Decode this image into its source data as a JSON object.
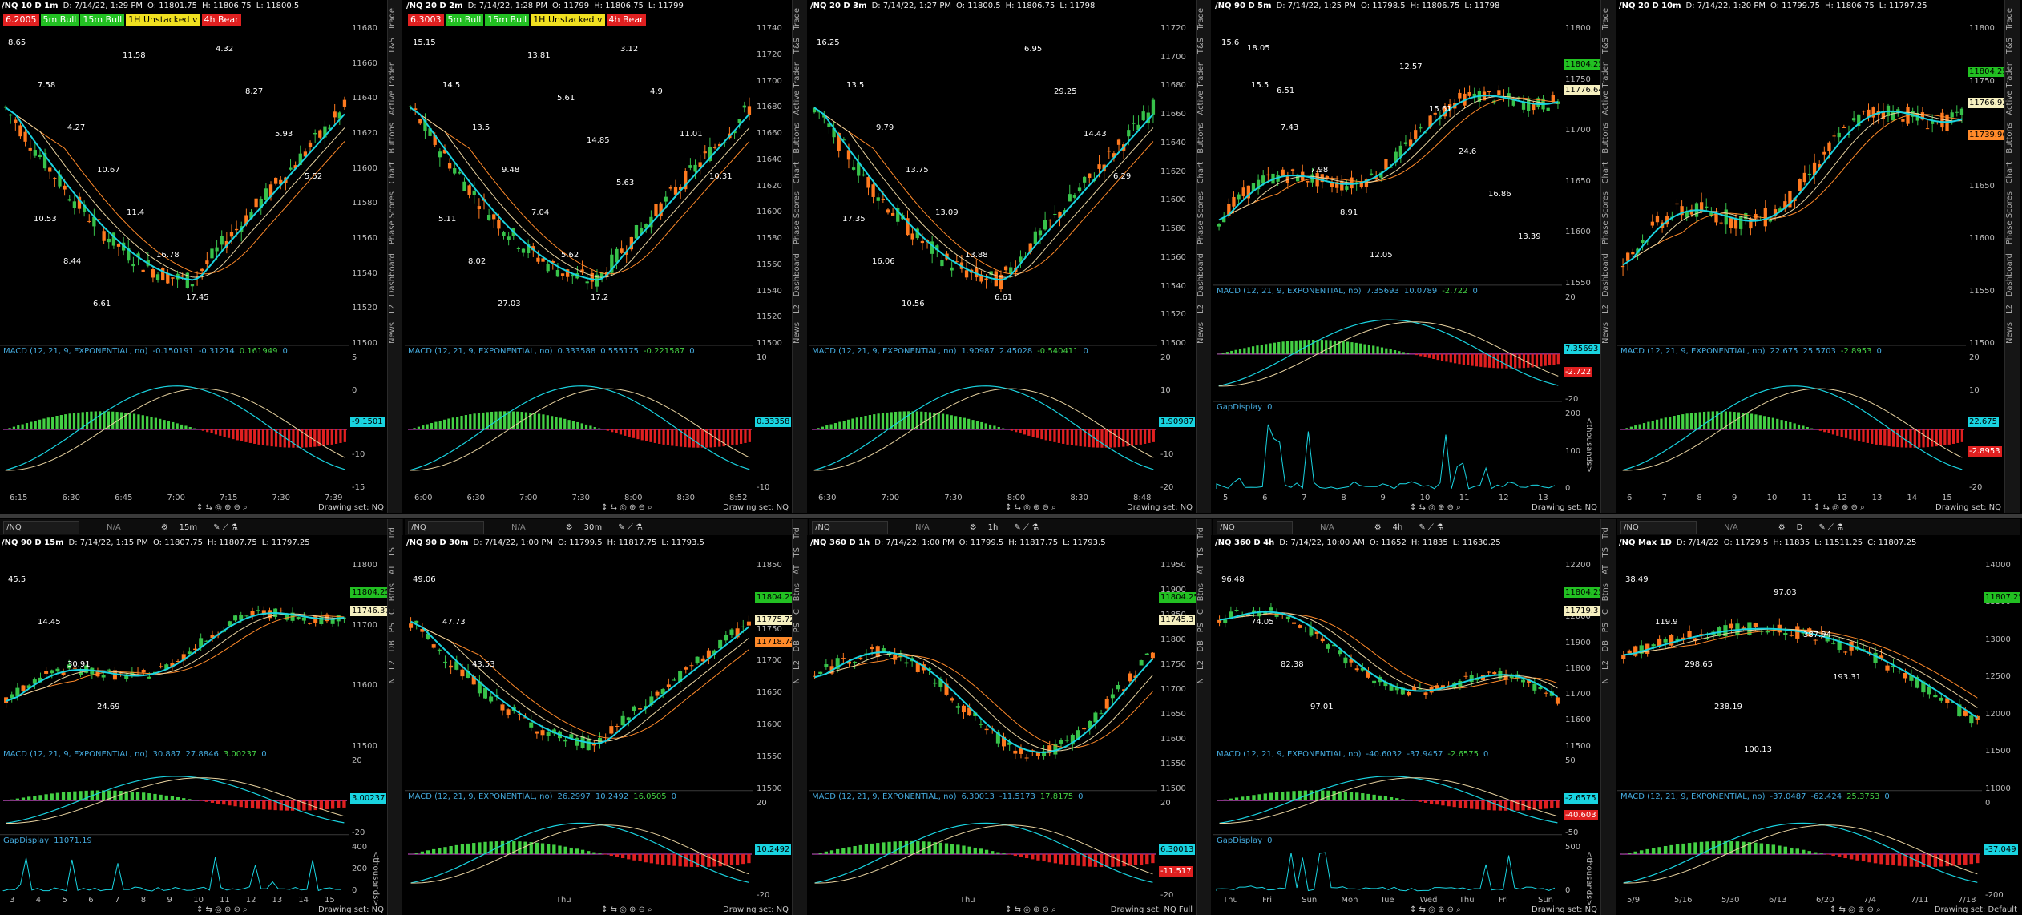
{
  "colors": {
    "bg": "#000000",
    "up": "#37c24a",
    "down": "#ff7a1f",
    "cyan": "#19d3e0",
    "orange": "#ff8a2a",
    "tan": "#e8d3a0",
    "macd_up": "#44d044",
    "macd_down": "#e02020",
    "magenta": "#ff44ff"
  },
  "top": [
    {
      "title": "/NQ 10 D 1m",
      "info": [
        "D: 7/14/22, 1:29 PM",
        "O: 11801.75",
        "H: 11806.75",
        "L: 11800.5"
      ],
      "badges": [
        {
          "t": "6.2005",
          "bg": "#e02020",
          "fg": "#fff"
        },
        {
          "t": "5m Bull",
          "bg": "#22c022",
          "fg": "#fff"
        },
        {
          "t": "15m Bull",
          "bg": "#22c022",
          "fg": "#fff"
        },
        {
          "t": "1H Unstacked v",
          "bg": "#f0e020",
          "fg": "#000"
        },
        {
          "t": "4h Bear",
          "bg": "#e02020",
          "fg": "#fff"
        }
      ],
      "yticks": [
        "11680",
        "11660",
        "11640",
        "11620",
        "11600",
        "11580",
        "11560",
        "11540",
        "11520",
        "11500"
      ],
      "annotations": [
        "8.65",
        "7.58",
        "4.27",
        "10.67",
        "11.4",
        "16.78",
        "17.45",
        "4.32",
        "8.27",
        "5.93",
        "5.52",
        "10.53",
        "8.44",
        "6.61",
        "11.58"
      ],
      "macd": [
        "MACD (12, 21, 9, EXPONENTIAL, no)",
        "-0.150191",
        "-0.31214",
        "0.161949",
        "0"
      ],
      "macdticks": [
        "5",
        "0",
        "-5",
        "-10",
        "-15"
      ],
      "macd_tag": "-9.1501",
      "xticks": [
        "6:15",
        "6:30",
        "6:45",
        "7:00",
        "7:15",
        "7:30",
        "7:39"
      ],
      "footer": "Drawing set: NQ",
      "tabs": [
        "Trade",
        "T&S",
        "Active Trader",
        "Buttons",
        "Chart",
        "Phase Scores",
        "Dashboard",
        "L2",
        "News"
      ]
    },
    {
      "title": "/NQ 20 D 2m",
      "info": [
        "D: 7/14/22, 1:28 PM",
        "O: 11799",
        "H: 11806.75",
        "L: 11799"
      ],
      "badges": [
        {
          "t": "6.3003",
          "bg": "#e02020",
          "fg": "#fff"
        },
        {
          "t": "5m Bull",
          "bg": "#22c022",
          "fg": "#fff"
        },
        {
          "t": "15m Bull",
          "bg": "#22c022",
          "fg": "#fff"
        },
        {
          "t": "1H Unstacked v",
          "bg": "#f0e020",
          "fg": "#000"
        },
        {
          "t": "4h Bear",
          "bg": "#e02020",
          "fg": "#fff"
        }
      ],
      "yticks": [
        "11740",
        "11720",
        "11700",
        "11680",
        "11660",
        "11640",
        "11620",
        "11600",
        "11580",
        "11560",
        "11540",
        "11520",
        "11500"
      ],
      "annotations": [
        "15.15",
        "14.5",
        "13.5",
        "9.48",
        "7.04",
        "5.62",
        "17.2",
        "3.12",
        "4.9",
        "11.01",
        "10.31",
        "5.11",
        "8.02",
        "27.03",
        "13.81",
        "5.61",
        "14.85",
        "5.63"
      ],
      "macd": [
        "MACD (12, 21, 9, EXPONENTIAL, no)",
        "0.333588",
        "0.555175",
        "-0.221587",
        "0"
      ],
      "macdticks": [
        "10",
        "0",
        "-10"
      ],
      "macd_tag": "0.33358",
      "xticks": [
        "6:00",
        "6:30",
        "7:00",
        "7:30",
        "8:00",
        "8:30",
        "8:52"
      ],
      "footer": "Drawing set: NQ",
      "tabs": [
        "Trade",
        "T&S",
        "Active Trader",
        "Buttons",
        "Chart",
        "Phase Scores",
        "Dashboard",
        "L2",
        "News"
      ]
    },
    {
      "title": "/NQ 20 D 3m",
      "info": [
        "D: 7/14/22, 1:27 PM",
        "O: 11800.5",
        "H: 11806.75",
        "L: 11798"
      ],
      "badges": [],
      "yticks": [
        "11720",
        "11700",
        "11680",
        "11660",
        "11640",
        "11620",
        "11600",
        "11580",
        "11560",
        "11540",
        "11520",
        "11500"
      ],
      "annotations": [
        "16.25",
        "13.5",
        "9.79",
        "13.75",
        "13.09",
        "13.88",
        "6.61",
        "6.95",
        "29.25",
        "14.43",
        "6.29",
        "17.35",
        "16.06",
        "10.56"
      ],
      "macd": [
        "MACD (12, 21, 9, EXPONENTIAL, no)",
        "1.90987",
        "2.45028",
        "-0.540411",
        "0"
      ],
      "macdticks": [
        "20",
        "10",
        "0",
        "-10",
        "-20"
      ],
      "macd_tag": "1.90987",
      "xticks": [
        "6:30",
        "7:00",
        "7:30",
        "8:00",
        "8:30",
        "8:48"
      ],
      "footer": "Drawing set: NQ",
      "tabs": [
        "Trade",
        "T&S",
        "Active Trader",
        "Buttons",
        "Chart",
        "Phase Scores",
        "Dashboard",
        "L2",
        "News"
      ]
    },
    {
      "title": "/NQ 90 D 5m",
      "info": [
        "D: 7/14/22, 1:25 PM",
        "O: 11798.5",
        "H: 11806.75",
        "L: 11798"
      ],
      "badges": [],
      "yticks": [
        "11800",
        "11750",
        "11700",
        "11650",
        "11600",
        "11550"
      ],
      "annotations": [
        "15.6",
        "15.5",
        "7.43",
        "7.98",
        "8.91",
        "12.05",
        "12.57",
        "15.61",
        "24.6",
        "16.86",
        "13.39",
        "18.05",
        "6.51"
      ],
      "macd": [
        "MACD (12, 21, 9, EXPONENTIAL, no)",
        "7.35693",
        "10.0789",
        "-2.722",
        "0"
      ],
      "macdticks": [
        "20",
        "0",
        "-20"
      ],
      "macd_tag": "7.35693",
      "macd_tag2": "-2.722",
      "gap": [
        "GapDisplay",
        "0"
      ],
      "gapticks": [
        "200",
        "100",
        "0"
      ],
      "gapunit": "<thousands>",
      "price_tags": [
        "11804.25",
        "11776.64"
      ],
      "xticks": [
        "5",
        "6",
        "7",
        "8",
        "9",
        "10",
        "11",
        "12",
        "13"
      ],
      "footer": "Drawing set: NQ",
      "tabs": [
        "Trade",
        "T&S",
        "Active Trader",
        "Buttons",
        "Chart",
        "Phase Scores",
        "Dashboard",
        "L2",
        "News"
      ]
    },
    {
      "title": "/NQ 20 D 10m",
      "info": [
        "D: 7/14/22, 1:20 PM",
        "O: 11799.75",
        "H: 11806.75",
        "L: 11797.25"
      ],
      "badges": [],
      "yticks": [
        "11800",
        "11750",
        "11700",
        "11650",
        "11600",
        "11550",
        "11500"
      ],
      "annotations": [],
      "macd": [
        "MACD (12, 21, 9, EXPONENTIAL, no)",
        "22.675",
        "25.5703",
        "-2.8953",
        "0"
      ],
      "macdticks": [
        "20",
        "10",
        "0",
        "-10",
        "-20"
      ],
      "macd_tag": "22.675",
      "macd_tag2": "-2.8953",
      "price_tags": [
        "11804.25",
        "11766.92",
        "11739.96"
      ],
      "xticks": [
        "6",
        "7",
        "8",
        "9",
        "10",
        "11",
        "12",
        "13",
        "14",
        "15"
      ],
      "footer": "Drawing set: NQ",
      "tabs": [
        "Trade",
        "T&S",
        "Active Trader",
        "Buttons",
        "Chart",
        "Phase Scores",
        "Dashboard",
        "L2",
        "News"
      ]
    }
  ],
  "bottom": [
    {
      "sym": "/NQ",
      "na": "N/A",
      "agg": "15m",
      "title": "/NQ 90 D 15m",
      "info": [
        "D: 7/14/22, 1:15 PM",
        "O: 11807.75",
        "H: 11807.75",
        "L: 11797.25"
      ],
      "yticks": [
        "11800",
        "11700",
        "11600",
        "11500"
      ],
      "annotations": [
        "45.5",
        "14.45",
        "30.91",
        "24.69"
      ],
      "macd": [
        "MACD (12, 21, 9, EXPONENTIAL, no)",
        "30.887",
        "27.8846",
        "3.00237",
        "0"
      ],
      "macdticks": [
        "20",
        "0",
        "-20"
      ],
      "macd_tag": "3.00237",
      "price_tags": [
        "11804.25",
        "11746.37"
      ],
      "gap": [
        "GapDisplay",
        "11071.19"
      ],
      "gapticks": [
        "400",
        "200",
        "0"
      ],
      "gapunit": "<thousands>",
      "xticks": [
        "3",
        "4",
        "5",
        "6",
        "7",
        "8",
        "9",
        "10",
        "11",
        "12",
        "13",
        "14",
        "15"
      ],
      "footer": "Drawing set: NQ",
      "tabs": [
        "Trd",
        "TS",
        "AT",
        "Btns",
        "C",
        "PS",
        "DB",
        "L2",
        "N"
      ]
    },
    {
      "sym": "/NQ",
      "na": "N/A",
      "agg": "30m",
      "title": "/NQ 90 D 30m",
      "info": [
        "D: 7/14/22, 1:00 PM",
        "O: 11799.5",
        "H: 11817.75",
        "L: 11793.5"
      ],
      "yticks": [
        "11850",
        "11800",
        "11750",
        "11700",
        "11650",
        "11600",
        "11550",
        "11500"
      ],
      "annotations": [
        "49.06",
        "47.73",
        "43.53"
      ],
      "macd": [
        "MACD (12, 21, 9, EXPONENTIAL, no)",
        "26.2997",
        "10.2492",
        "16.0505",
        "0"
      ],
      "macdticks": [
        "20",
        "0",
        "-20"
      ],
      "macd_tag": "10.2492",
      "price_tags": [
        "11804.25",
        "11775.72",
        "11718.74"
      ],
      "xticks": [
        "Thu"
      ],
      "footer": "Drawing set: NQ",
      "tabs": [
        "Trd",
        "TS",
        "AT",
        "Btns",
        "C",
        "PS",
        "DB",
        "L2",
        "N"
      ]
    },
    {
      "sym": "/NQ",
      "na": "N/A",
      "agg": "1h",
      "title": "/NQ 360 D 1h",
      "info": [
        "D: 7/14/22, 1:00 PM",
        "O: 11799.5",
        "H: 11817.75",
        "L: 11793.5"
      ],
      "yticks": [
        "11950",
        "11900",
        "11850",
        "11800",
        "11750",
        "11700",
        "11650",
        "11600",
        "11550",
        "11500"
      ],
      "annotations": [],
      "macd": [
        "MACD (12, 21, 9, EXPONENTIAL, no)",
        "6.30013",
        "-11.5173",
        "17.8175",
        "0"
      ],
      "macdticks": [
        "20",
        "0",
        "-20"
      ],
      "macd_tag": "6.30013",
      "macd_tag2": "-11.517",
      "price_tags": [
        "11804.25",
        "11745.3"
      ],
      "xticks": [
        "Thu"
      ],
      "footer": "Drawing set: NQ Full",
      "tabs": [
        "Trd",
        "TS",
        "AT",
        "Btns",
        "C",
        "PS",
        "DB",
        "L2",
        "N"
      ]
    },
    {
      "sym": "/NQ",
      "na": "N/A",
      "agg": "4h",
      "title": "/NQ 360 D 4h",
      "info": [
        "D: 7/14/22, 10:00 AM",
        "O: 11652",
        "H: 11835",
        "L: 11630.25"
      ],
      "yticks": [
        "12200",
        "12100",
        "12000",
        "11900",
        "11800",
        "11700",
        "11600",
        "11500"
      ],
      "annotations": [
        "96.48",
        "74.05",
        "82.38",
        "97.01"
      ],
      "macd": [
        "MACD (12, 21, 9, EXPONENTIAL, no)",
        "-40.6032",
        "-37.9457",
        "-2.6575",
        "0"
      ],
      "macdticks": [
        "50",
        "0",
        "-50"
      ],
      "macd_tag": "-2.6575",
      "macd_tag2": "-40.603",
      "price_tags": [
        "11804.25",
        "11719.3"
      ],
      "gap": [
        "GapDisplay",
        "0"
      ],
      "gapticks": [
        "500",
        "0"
      ],
      "gapunit": "<thousands>",
      "xticks": [
        "Thu",
        "Fri",
        "Sun",
        "Mon",
        "Tue",
        "Wed",
        "Thu",
        "Fri",
        "Sun"
      ],
      "footer": "Drawing set: NQ",
      "tabs": [
        "Trd",
        "TS",
        "AT",
        "Btns",
        "C",
        "PS",
        "DB",
        "L2",
        "N"
      ]
    },
    {
      "sym": "/NQ",
      "na": "N/A",
      "agg": "D",
      "title": "/NQ Max 1D",
      "info": [
        "D: 7/14/22",
        "O: 11729.5",
        "H: 11835",
        "L: 11511.25",
        "C: 11807.25"
      ],
      "yticks": [
        "14000",
        "13500",
        "13000",
        "12500",
        "12000",
        "11500",
        "11000"
      ],
      "annotations": [
        "38.49",
        "119.9",
        "298.65",
        "238.19",
        "100.13",
        "97.03",
        "387.94",
        "193.31"
      ],
      "macd": [
        "MACD (12, 21, 9, EXPONENTIAL, no)",
        "-37.0487",
        "-62.424",
        "25.3753",
        "0"
      ],
      "macdticks": [
        "0",
        "-200"
      ],
      "macd_tag": "-37.049",
      "price_tags": [
        "11807.25"
      ],
      "xticks": [
        "5/9",
        "5/16",
        "5/30",
        "6/13",
        "6/20",
        "7/4",
        "7/11",
        "7/18"
      ],
      "footer": "Drawing set: Default",
      "tabs": []
    }
  ]
}
